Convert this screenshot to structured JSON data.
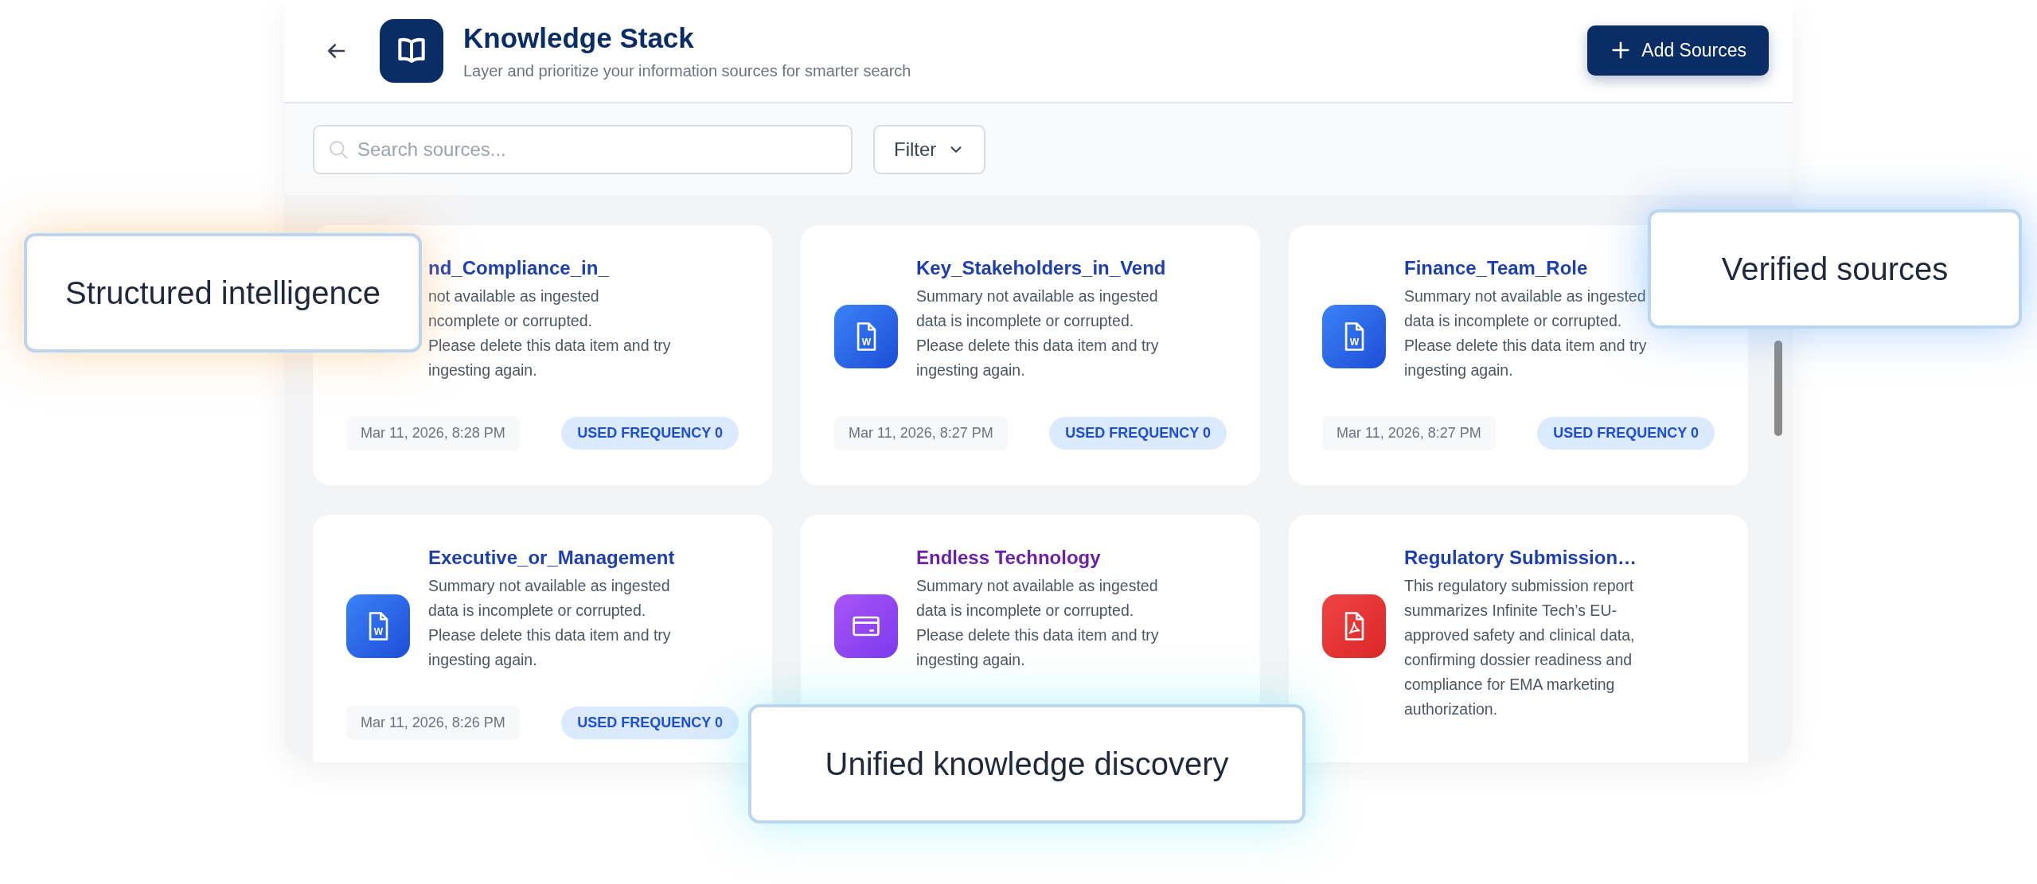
{
  "header": {
    "title": "Knowledge Stack",
    "subtitle": "Layer and prioritize your information sources for smarter search",
    "add_button": "Add Sources"
  },
  "toolbar": {
    "search": {
      "placeholder": "Search sources..."
    },
    "filter": "Filter"
  },
  "cards": [
    {
      "title": "nd_Compliance_in_",
      "summary": "not available as ingested\nncomplete or corrupted.\nPlease delete this data item and try\ningesting again.",
      "date": "Mar 11, 2026, 8:28 PM",
      "badge": "USED FREQUENCY 0"
    },
    {
      "kind": "word",
      "glyph": "W",
      "title": "Key_Stakeholders_in_Vend",
      "summary": "Summary not available as ingested\ndata is incomplete or corrupted.\nPlease delete this data item and try\ningesting again.",
      "date": "Mar 11, 2026, 8:27 PM",
      "badge": "USED FREQUENCY 0"
    },
    {
      "kind": "word",
      "glyph": "W",
      "title": "Finance_Team_Role",
      "summary": "Summary not available as ingested\ndata is incomplete or corrupted.\nPlease delete this data item and try\ningesting again.",
      "date": "Mar 11, 2026, 8:27 PM",
      "badge": "USED FREQUENCY 0"
    },
    {
      "kind": "word",
      "glyph": "W",
      "title": "Executive_or_Management",
      "summary": "Summary not available as ingested\ndata is incomplete or corrupted.\nPlease delete this data item and try\ningesting again.",
      "date": "Mar 11, 2026, 8:26 PM",
      "badge": "USED FREQUENCY 0"
    },
    {
      "kind": "card",
      "title": "Endless Technology",
      "summary": "Summary not available as ingested\ndata is incomplete or corrupted.\nPlease delete this data item and try\ningesting again."
    },
    {
      "kind": "pdf",
      "title": "Regulatory Submission…",
      "summary": "This regulatory submission report\nsummarizes Infinite Tech’s EU-\napproved safety and clinical data,\nconfirming dossier readiness and\ncompliance for EMA marketing\nauthorization."
    }
  ],
  "callouts": [
    {
      "kind": "warm",
      "text": "Structured intelligence"
    },
    {
      "kind": "blue",
      "text": "Verified sources"
    },
    {
      "kind": "cyan",
      "text": "Unified knowledge discovery"
    }
  ]
}
